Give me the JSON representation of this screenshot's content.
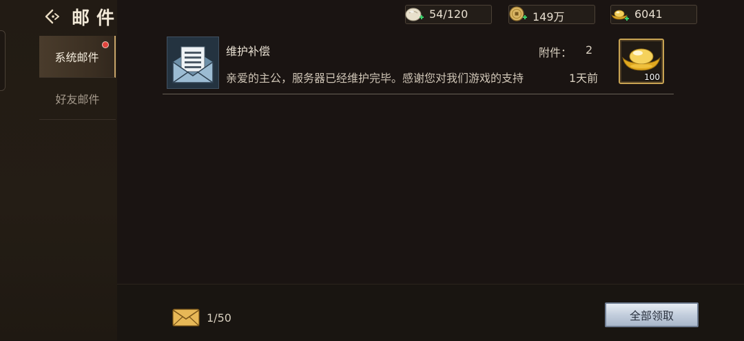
{
  "header": {
    "title": "邮件"
  },
  "sidebar": {
    "items": [
      {
        "label": "系统邮件",
        "active": true,
        "has_notification": true
      },
      {
        "label": "好友邮件",
        "active": false,
        "has_notification": false
      }
    ]
  },
  "resources": {
    "stamina": {
      "value": "54/120",
      "icon": "steamed-bun-icon"
    },
    "coins": {
      "value": "149万",
      "icon": "copper-coin-icon"
    },
    "gold_ingots": {
      "value": "6041",
      "icon": "gold-ingot-icon"
    }
  },
  "mail": {
    "items": [
      {
        "subject": "维护补偿",
        "body": "亲爱的主公，服务器已经维护完毕。感谢您对我们游戏的支持",
        "attachment_label": "附件：",
        "attachment_count": "2",
        "time": "1天前",
        "reward": {
          "icon": "gold-ingot-icon",
          "quantity": "100"
        }
      }
    ]
  },
  "footer": {
    "mail_count": "1/50",
    "claim_all_label": "全部领取"
  },
  "colors": {
    "accent_gold": "#c9a453",
    "notification_red": "#e0443d",
    "button_silver": "#c3cedd"
  }
}
